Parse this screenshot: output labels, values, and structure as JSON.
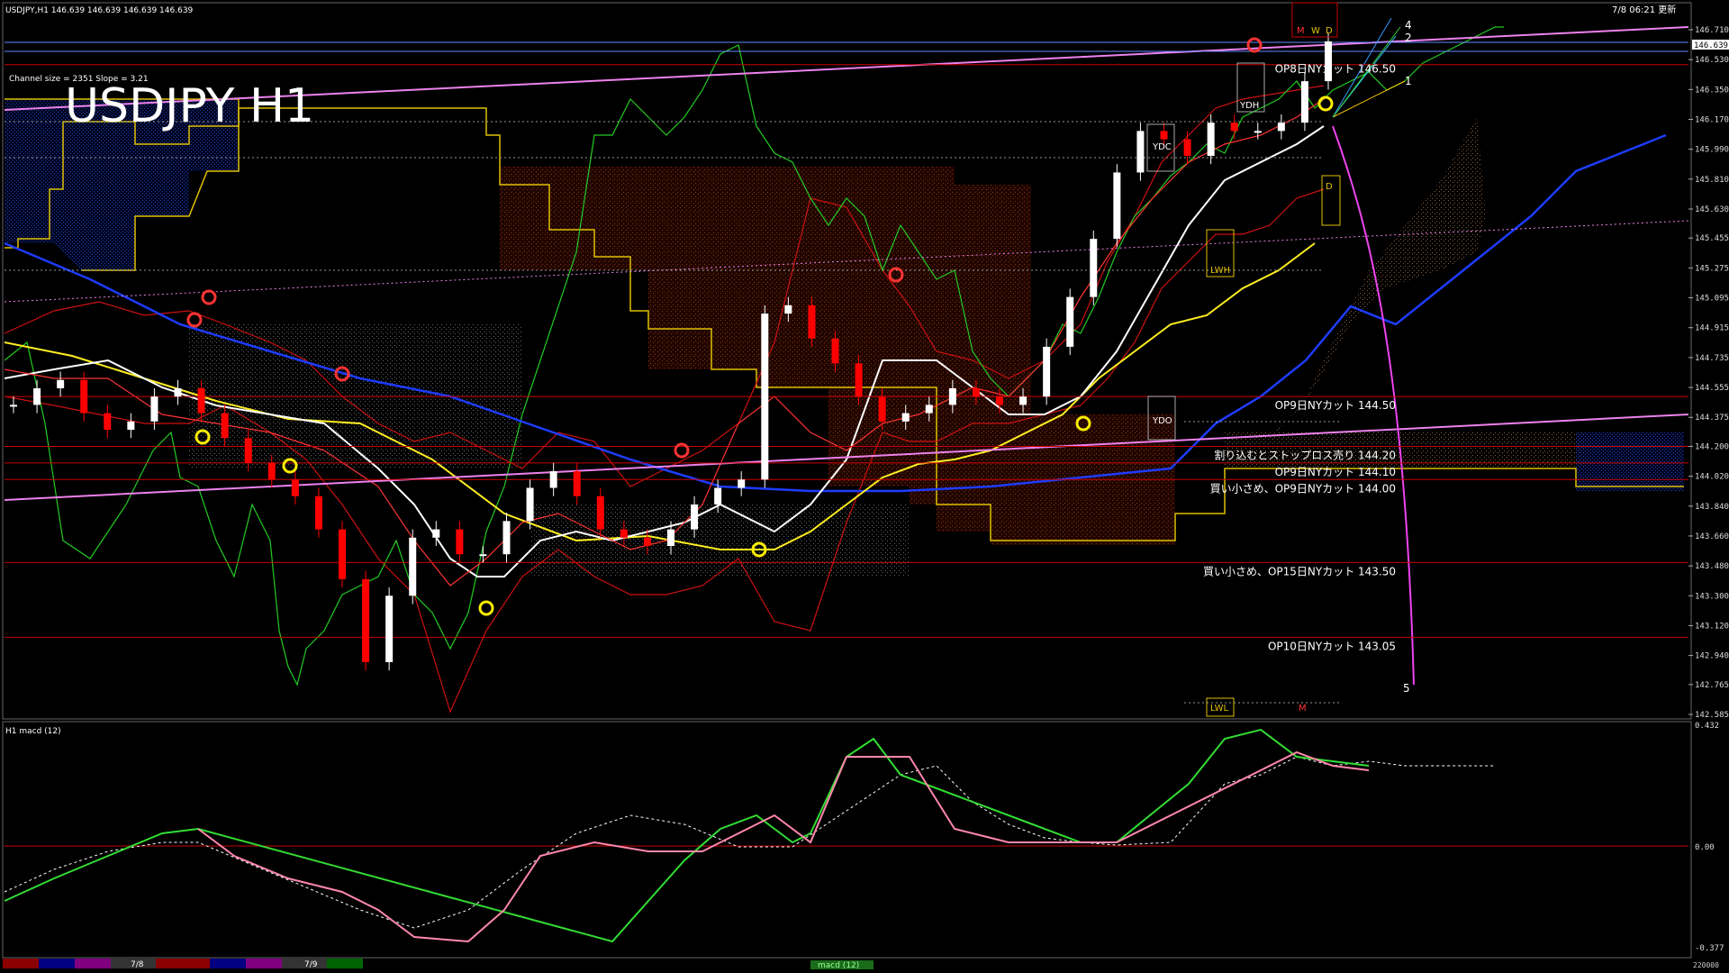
{
  "header": {
    "symbol_line": "USDJPY,H1  146.639 146.639 146.639 146.639",
    "datetime": "7/8 06:21 更新"
  },
  "big_title": "USDJPY H1",
  "channel_info": "Channel size = 2351 Slope = 3.21",
  "price_axis": {
    "ticks": [
      "146.710",
      "146.530",
      "146.350",
      "146.170",
      "145.990",
      "145.810",
      "145.630",
      "145.455",
      "145.275",
      "145.095",
      "144.915",
      "144.735",
      "144.555",
      "144.375",
      "144.200",
      "144.020",
      "143.840",
      "143.660",
      "143.480",
      "143.300",
      "143.120",
      "142.940",
      "142.765",
      "142.585"
    ],
    "current_price": "146.639",
    "current_price_color": "#ffffff"
  },
  "macd_panel": {
    "label": "H1  macd (12)",
    "ticks": [
      "0.432",
      "0.00",
      "-0.377"
    ]
  },
  "level_lines": [
    {
      "label": "OP8日NYカット 146.50",
      "price": 146.5
    },
    {
      "label": "OP9日NYカット 144.50",
      "price": 144.5
    },
    {
      "label": "割り込むとストップロス売り 144.20",
      "price": 144.2
    },
    {
      "label": "OP9日NYカット 144.10",
      "price": 144.1
    },
    {
      "label": "買い小さめ、OP9日NYカット 144.00",
      "price": 144.0
    },
    {
      "label": "買い小さめ、OP15日NYカット 143.50",
      "price": 143.5
    },
    {
      "label": "OP10日NYカット 143.05",
      "price": 143.05
    }
  ],
  "markers": {
    "ydc": "YDC",
    "ydh": "YDH",
    "ydo": "YDO",
    "lwh": "LWH",
    "lwl": "LWL",
    "m": "M",
    "w": "W",
    "d": "D",
    "d2": "D",
    "n1": "1",
    "n2": "2",
    "n4": "4",
    "n5": "5"
  },
  "bottom_bar": {
    "date1": "7/8",
    "date2": "7/9",
    "tab": "macd (12)",
    "right_value": "220000"
  },
  "colors": {
    "background": "#000000",
    "candle_up": "#ffffff",
    "candle_down": "#ff0000",
    "kumo": "#e06030",
    "level_line": "#cc0000",
    "channel": "#ee82ee",
    "ema_white": "#ffffff",
    "ema_yellow": "#ffff00",
    "ema_blue": "#1e3cff",
    "chikou": "#22cc22",
    "macd_up": "#33dd33",
    "macd_down": "#ff88aa"
  },
  "chart_data": {
    "type": "line",
    "symbol": "USDJPY",
    "timeframe": "H1",
    "ylim": [
      142.585,
      146.71
    ],
    "x_dates": [
      "7/8",
      "7/9"
    ],
    "series": [
      {
        "values": [
          144.45,
          144.55,
          144.6,
          144.4,
          144.3,
          144.35,
          144.5,
          144.55,
          144.4,
          144.25,
          144.1,
          144.0,
          143.9,
          143.7,
          143.4,
          142.9,
          143.3,
          143.65,
          143.7,
          143.55,
          143.55,
          143.75,
          143.95,
          144.05,
          143.9,
          143.7,
          143.65,
          143.6,
          143.7,
          143.85,
          143.95,
          144.0,
          145.0,
          145.05,
          144.85,
          144.7,
          144.5,
          144.35,
          144.4,
          144.45,
          144.55,
          144.5,
          144.45,
          144.5,
          144.8,
          145.1,
          145.45,
          145.85,
          146.1,
          146.05,
          145.95,
          146.15,
          146.1,
          146.1,
          146.15,
          146.4,
          146.64
        ]
      }
    ]
  }
}
